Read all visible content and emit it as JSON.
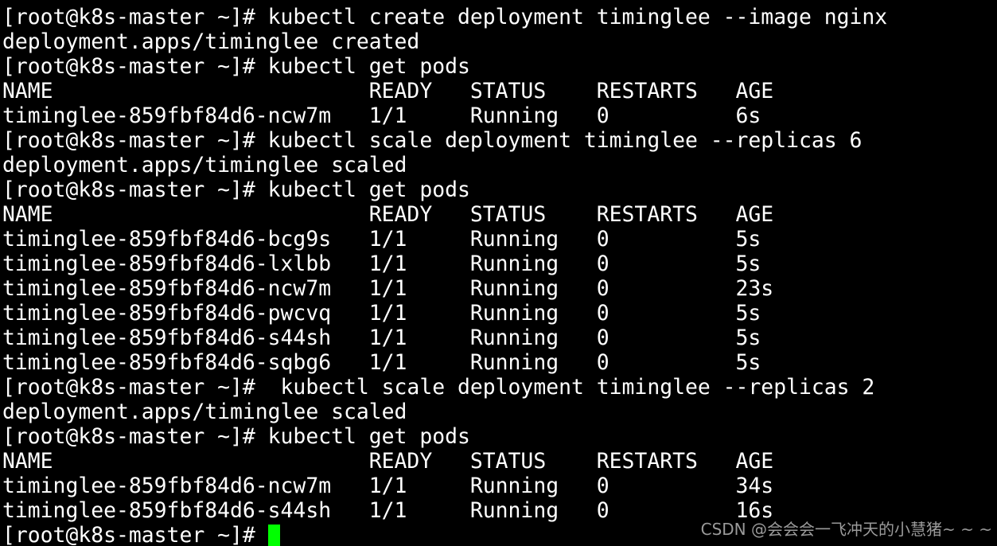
{
  "terminal": {
    "lines": [
      "[root@k8s-master ~]# kubectl create deployment timinglee --image nginx",
      "deployment.apps/timinglee created",
      "[root@k8s-master ~]# kubectl get pods",
      "NAME                         READY   STATUS    RESTARTS   AGE",
      "timinglee-859fbf84d6-ncw7m   1/1     Running   0          6s",
      "[root@k8s-master ~]# kubectl scale deployment timinglee --replicas 6",
      "deployment.apps/timinglee scaled",
      "[root@k8s-master ~]# kubectl get pods",
      "NAME                         READY   STATUS    RESTARTS   AGE",
      "timinglee-859fbf84d6-bcg9s   1/1     Running   0          5s",
      "timinglee-859fbf84d6-lxlbb   1/1     Running   0          5s",
      "timinglee-859fbf84d6-ncw7m   1/1     Running   0          23s",
      "timinglee-859fbf84d6-pwcvq   1/1     Running   0          5s",
      "timinglee-859fbf84d6-s44sh   1/1     Running   0          5s",
      "timinglee-859fbf84d6-sqbg6   1/1     Running   0          5s",
      "[root@k8s-master ~]#  kubectl scale deployment timinglee --replicas 2",
      "deployment.apps/timinglee scaled",
      "[root@k8s-master ~]# kubectl get pods",
      "NAME                         READY   STATUS    RESTARTS   AGE",
      "timinglee-859fbf84d6-ncw7m   1/1     Running   0          34s",
      "timinglee-859fbf84d6-s44sh   1/1     Running   0          16s"
    ],
    "prompt": "[root@k8s-master ~]# ",
    "cursor_color": "#00ff00",
    "background_color": "#000000",
    "text_color": "#ffffff"
  },
  "watermark": "CSDN @会会会一飞冲天的小慧猪~ ~ ~"
}
